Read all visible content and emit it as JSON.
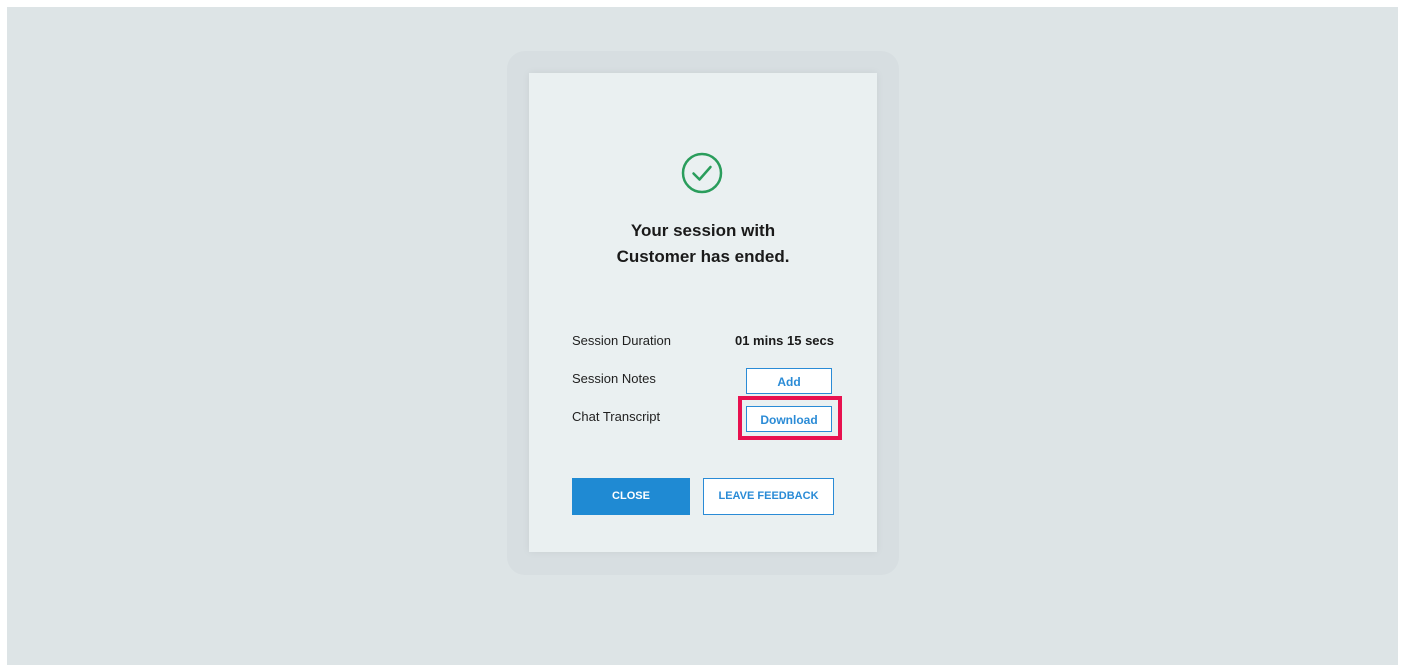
{
  "dialog": {
    "title_line1": "Your session with",
    "title_line2": "Customer has ended.",
    "icon": "check-circle-icon",
    "accent_color": "#2a9d5c",
    "rows": {
      "duration": {
        "label": "Session Duration",
        "value": "01 mins 15 secs"
      },
      "notes": {
        "label": "Session Notes",
        "button": "Add"
      },
      "transcript": {
        "label": "Chat Transcript",
        "button": "Download"
      }
    },
    "buttons": {
      "close": "CLOSE",
      "feedback": "LEAVE FEEDBACK"
    },
    "primary_color": "#1f8ad3",
    "highlight_color": "#e8114f"
  }
}
